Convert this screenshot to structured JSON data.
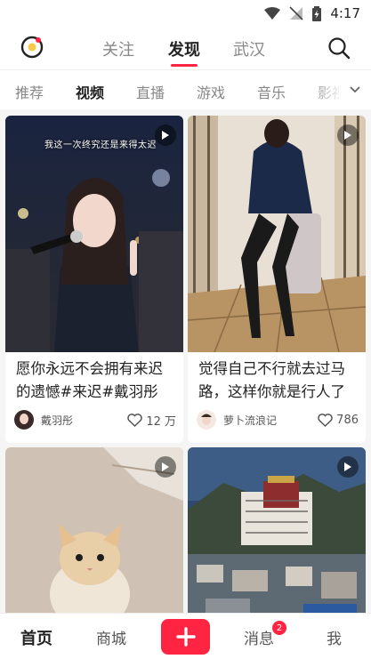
{
  "status_bar": {
    "time": "4:17"
  },
  "top_nav": {
    "tabs": [
      {
        "label": "关注",
        "active": false
      },
      {
        "label": "发现",
        "active": true
      },
      {
        "label": "武汉",
        "active": false
      }
    ],
    "accent_color": "#ff2442"
  },
  "categories": [
    "推荐",
    "视频",
    "直播",
    "游戏",
    "音乐",
    "影视"
  ],
  "active_category": "视频",
  "feed": [
    {
      "title": "愿你永远不会拥有来迟的遗憾#来迟#戴羽彤",
      "author": "戴羽彤",
      "likes": "12 万",
      "overlay": "我这一次终究还是来得太迟",
      "type": "video"
    },
    {
      "title": "觉得自己不行就去过马路，这样你就是行人了",
      "author": "萝卜流浪记",
      "likes": "786",
      "type": "video"
    },
    {
      "type": "video"
    },
    {
      "type": "video"
    }
  ],
  "bottom_nav": {
    "home": "首页",
    "mall": "商城",
    "messages": "消息",
    "messages_badge": "2",
    "me": "我"
  }
}
